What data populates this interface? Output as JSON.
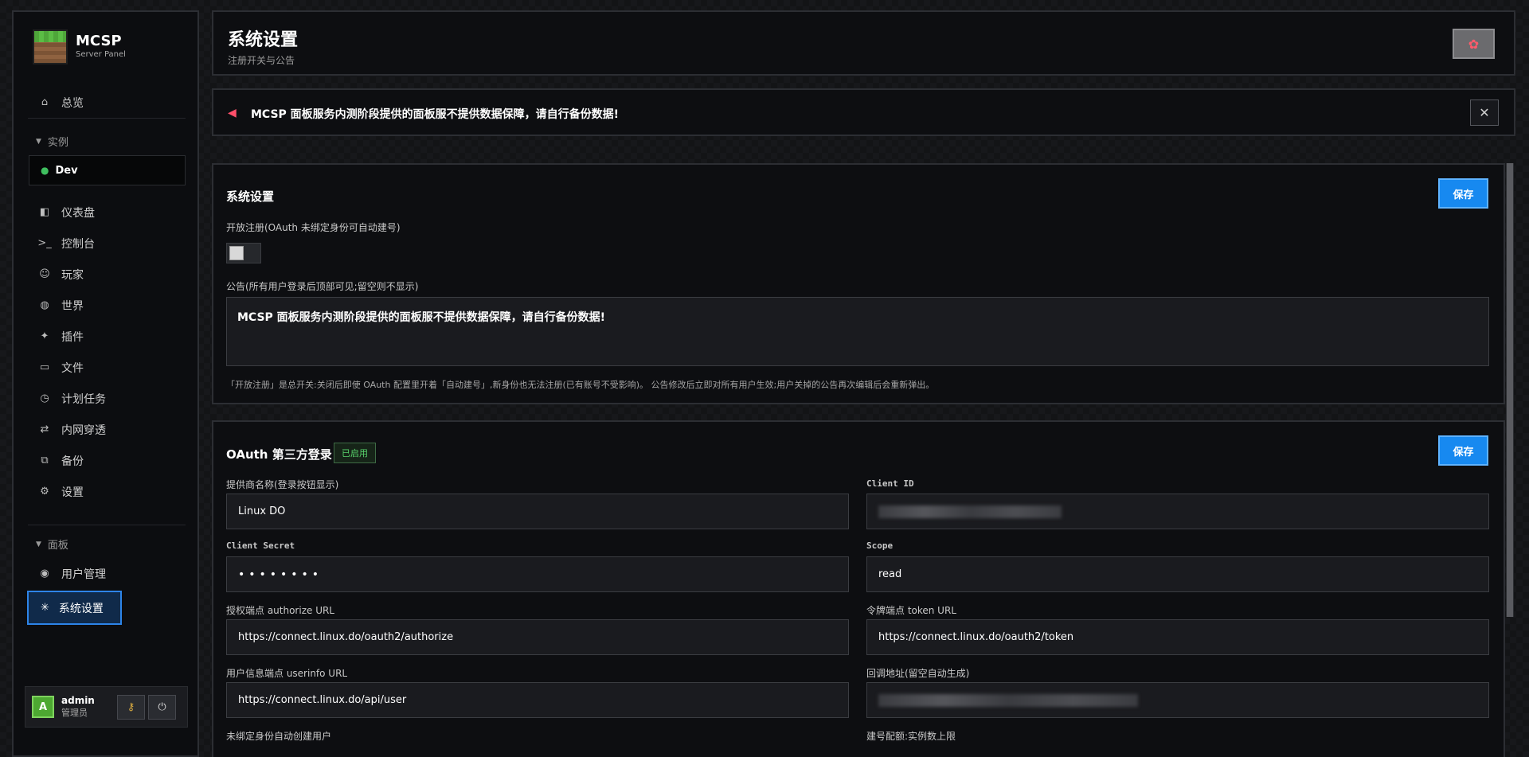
{
  "brand": {
    "name": "MCSP",
    "subtitle": "Server Panel"
  },
  "nav": {
    "overview": {
      "label": "总览",
      "icon": "home-icon"
    },
    "instances_section": "实例",
    "instance": {
      "name": "Dev",
      "status_color": "#3fbf5f"
    },
    "items": [
      {
        "label": "仪表盘",
        "icon": "dashboard-icon"
      },
      {
        "label": "控制台",
        "icon": "terminal-icon"
      },
      {
        "label": "玩家",
        "icon": "player-icon"
      },
      {
        "label": "世界",
        "icon": "globe-icon"
      },
      {
        "label": "插件",
        "icon": "plugin-icon"
      },
      {
        "label": "文件",
        "icon": "folder-icon"
      },
      {
        "label": "计划任务",
        "icon": "clock-icon"
      },
      {
        "label": "内网穿透",
        "icon": "tunnel-icon"
      },
      {
        "label": "备份",
        "icon": "backup-icon"
      },
      {
        "label": "设置",
        "icon": "gear-icon"
      }
    ],
    "panel_section": "面板",
    "user_management": {
      "label": "用户管理",
      "icon": "users-icon"
    },
    "system_settings": {
      "label": "系统设置",
      "icon": "asterisk-icon"
    }
  },
  "user": {
    "avatar": "A",
    "name": "admin",
    "role": "管理员"
  },
  "header": {
    "title": "系统设置",
    "subtitle": "注册开关与公告"
  },
  "notice": {
    "text": "MCSP 面板服务内测阶段提供的面板服不提供数据保障，请自行备份数据!",
    "close": "✕"
  },
  "system": {
    "title": "系统设置",
    "save": "保存",
    "registration_label": "开放注册(OAuth 未绑定身份可自动建号)",
    "registration_enabled": false,
    "announcement_label": "公告(所有用户登录后顶部可见;留空则不显示)",
    "announcement_value": "MCSP 面板服务内测阶段提供的面板服不提供数据保障，请自行备份数据!",
    "hint": "「开放注册」是总开关:关闭后即使 OAuth 配置里开着「自动建号」,新身份也无法注册(已有账号不受影响)。 公告修改后立即对所有用户生效;用户关掉的公告再次编辑后会重新弹出。"
  },
  "oauth": {
    "title": "OAuth 第三方登录",
    "badge": "已启用",
    "save": "保存",
    "provider_label": "提供商名称(登录按钮显示)",
    "provider_value": "Linux DO",
    "client_id_label": "Client ID",
    "client_secret_label": "Client Secret",
    "client_secret_value": "••••••••",
    "scope_label": "Scope",
    "scope_value": "read",
    "authorize_label": "授权端点 authorize URL",
    "authorize_value": "https://connect.linux.do/oauth2/authorize",
    "token_label": "令牌端点 token URL",
    "token_value": "https://connect.linux.do/oauth2/token",
    "userinfo_label": "用户信息端点 userinfo URL",
    "userinfo_value": "https://connect.linux.do/api/user",
    "callback_label": "回调地址(留空自动生成)",
    "auto_create_label": "未绑定身份自动创建用户",
    "quota_label": "建号配额:实例数上限"
  },
  "colors": {
    "accent": "#1789f0",
    "success": "#58d36b",
    "active_nav": "#2d84e8"
  }
}
